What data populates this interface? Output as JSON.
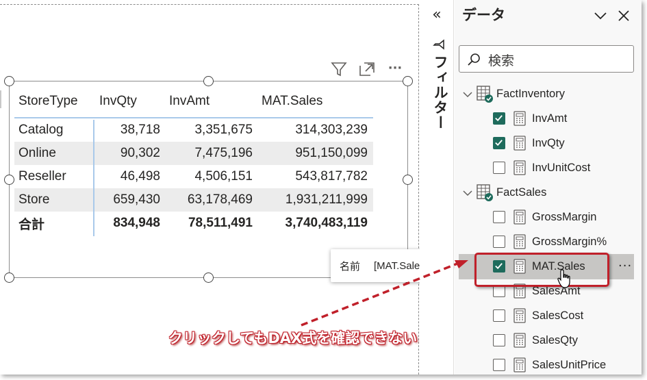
{
  "table": {
    "headers": [
      "StoreType",
      "InvQty",
      "InvAmt",
      "MAT.Sales"
    ],
    "rows": [
      [
        "Catalog",
        "38,718",
        "3,351,675",
        "314,303,239"
      ],
      [
        "Online",
        "90,302",
        "7,475,196",
        "951,150,099"
      ],
      [
        "Reseller",
        "46,498",
        "4,506,151",
        "543,817,782"
      ],
      [
        "Store",
        "659,430",
        "63,178,469",
        "1,931,211,999"
      ]
    ],
    "total": [
      "合計",
      "834,948",
      "78,511,491",
      "3,740,483,119"
    ]
  },
  "visual_header": {
    "icons": [
      "filter-icon",
      "focus-mode-icon",
      "more-options-icon"
    ],
    "more_label": "···"
  },
  "tooltip": {
    "label": "名前",
    "value": "[MAT.Sales]"
  },
  "filter_pane": {
    "collapse_glyph": "«",
    "label": "フィルター"
  },
  "data_pane": {
    "title": "データ",
    "search_placeholder": "検索",
    "tables": [
      {
        "name": "FactInventory",
        "fields": [
          {
            "name": "InvAmt",
            "checked": true
          },
          {
            "name": "InvQty",
            "checked": true
          },
          {
            "name": "InvUnitCost",
            "checked": false
          }
        ]
      },
      {
        "name": "FactSales",
        "fields": [
          {
            "name": "GrossMargin",
            "checked": false
          },
          {
            "name": "GrossMargin%",
            "checked": false
          },
          {
            "name": "MAT.Sales",
            "checked": true,
            "selected": true
          },
          {
            "name": "SalesAmt",
            "checked": false
          },
          {
            "name": "SalesCost",
            "checked": false
          },
          {
            "name": "SalesQty",
            "checked": false
          },
          {
            "name": "SalesUnitPrice",
            "checked": false
          }
        ]
      }
    ],
    "more_label": "···"
  },
  "annotation": {
    "text": "クリックしてもDAX式を確認できない",
    "color": "#c0202a"
  },
  "colors": {
    "checkbox_checked": "#1e6b5c",
    "selected_row": "#c7c6c4",
    "table_divider": "#a9c9ea",
    "alt_row": "#ececec"
  }
}
